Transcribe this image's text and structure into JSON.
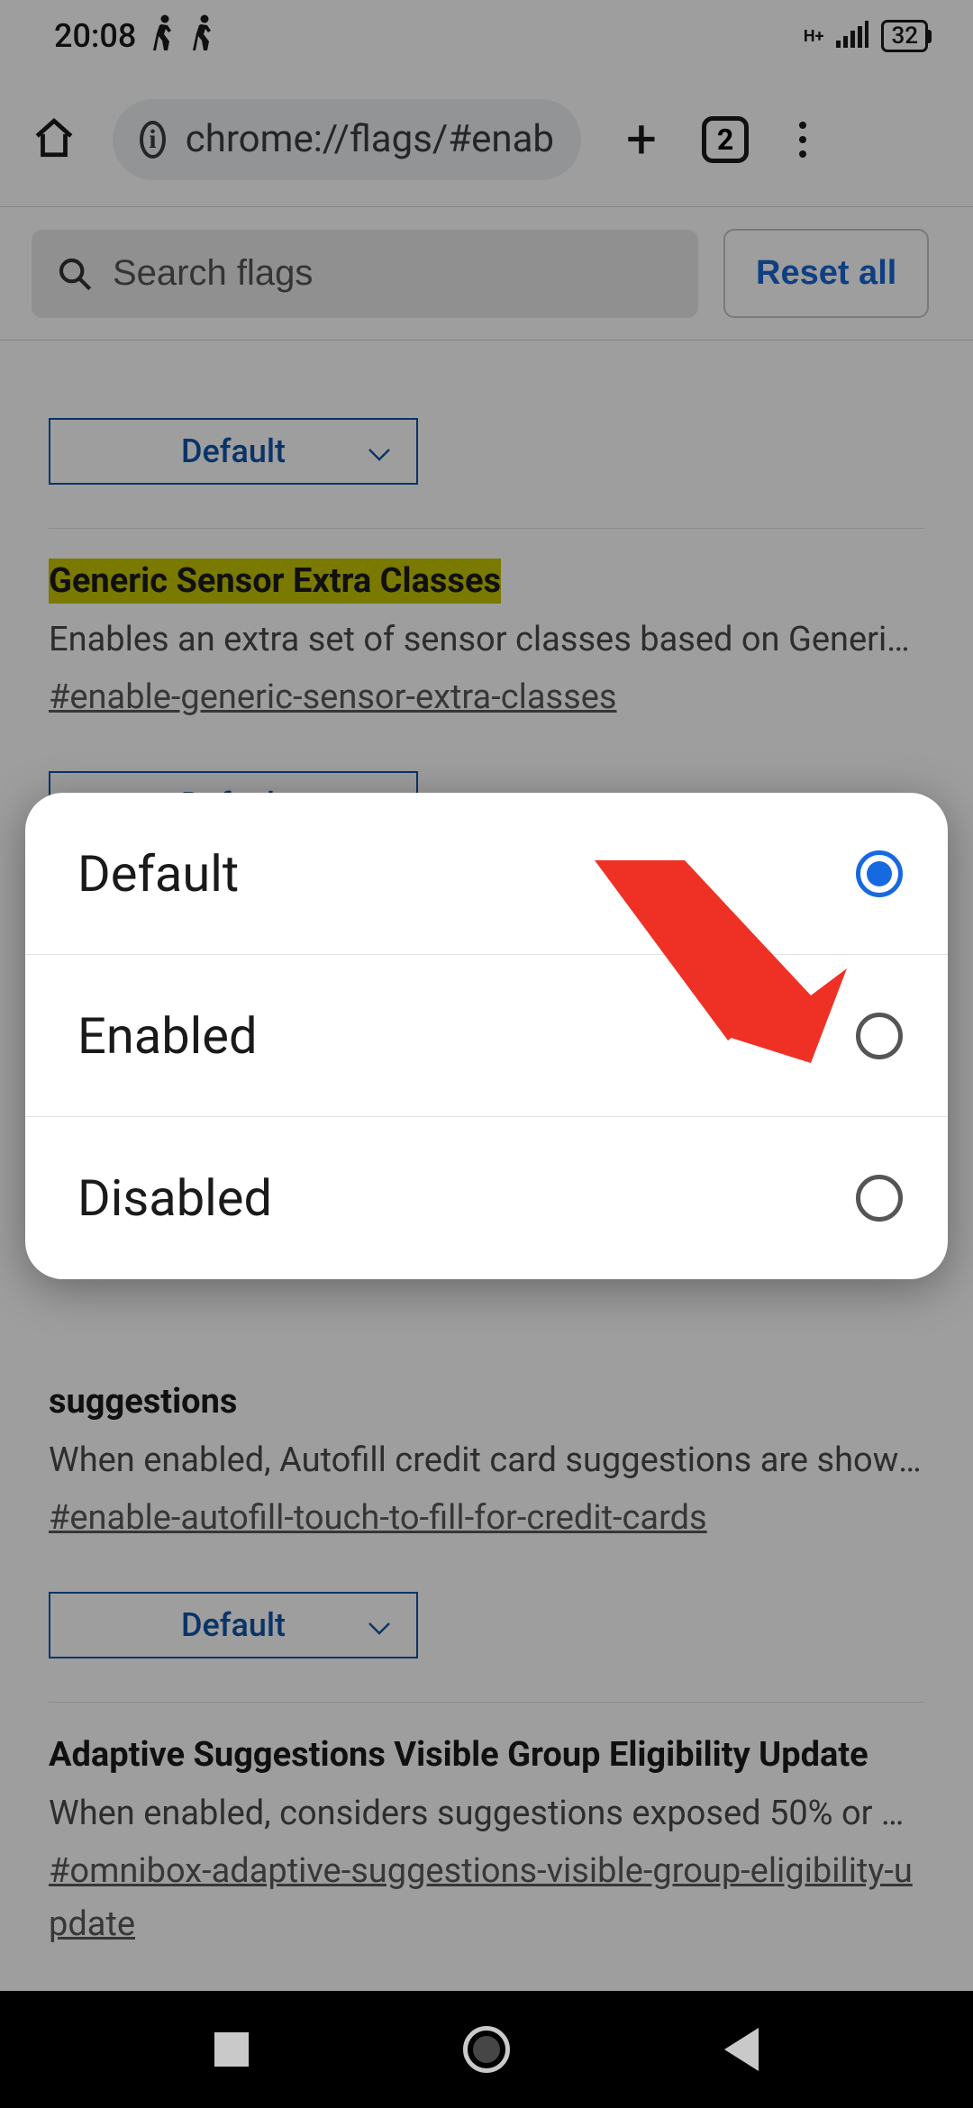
{
  "status_bar": {
    "time": "20:08",
    "network_type": "H+",
    "battery": "32"
  },
  "browser": {
    "url": "chrome://flags/#enab",
    "tab_count": "2"
  },
  "search": {
    "placeholder": "Search flags"
  },
  "reset_label": "Reset all",
  "flags": [
    {
      "title": "",
      "desc": "",
      "anchor": "",
      "select_value": "Default"
    },
    {
      "title": "Generic Sensor Extra Classes",
      "desc": "Enables an extra set of sensor classes based on Generic S…",
      "anchor": "#enable-generic-sensor-extra-classes",
      "select_value": "Default"
    },
    {
      "title": "suggestions",
      "desc": "When enabled, Autofill credit card suggestions are shown …",
      "anchor": "#enable-autofill-touch-to-fill-for-credit-cards",
      "select_value": "Default"
    },
    {
      "title": "Adaptive Suggestions Visible Group Eligibility Update",
      "desc": "When enabled, considers suggestions exposed 50% or mor…",
      "anchor": "#omnibox-adaptive-suggestions-visible-group-eligibility-update",
      "select_value": "Default"
    }
  ],
  "popup": {
    "options": [
      "Default",
      "Enabled",
      "Disabled"
    ],
    "selected_index": 0
  }
}
